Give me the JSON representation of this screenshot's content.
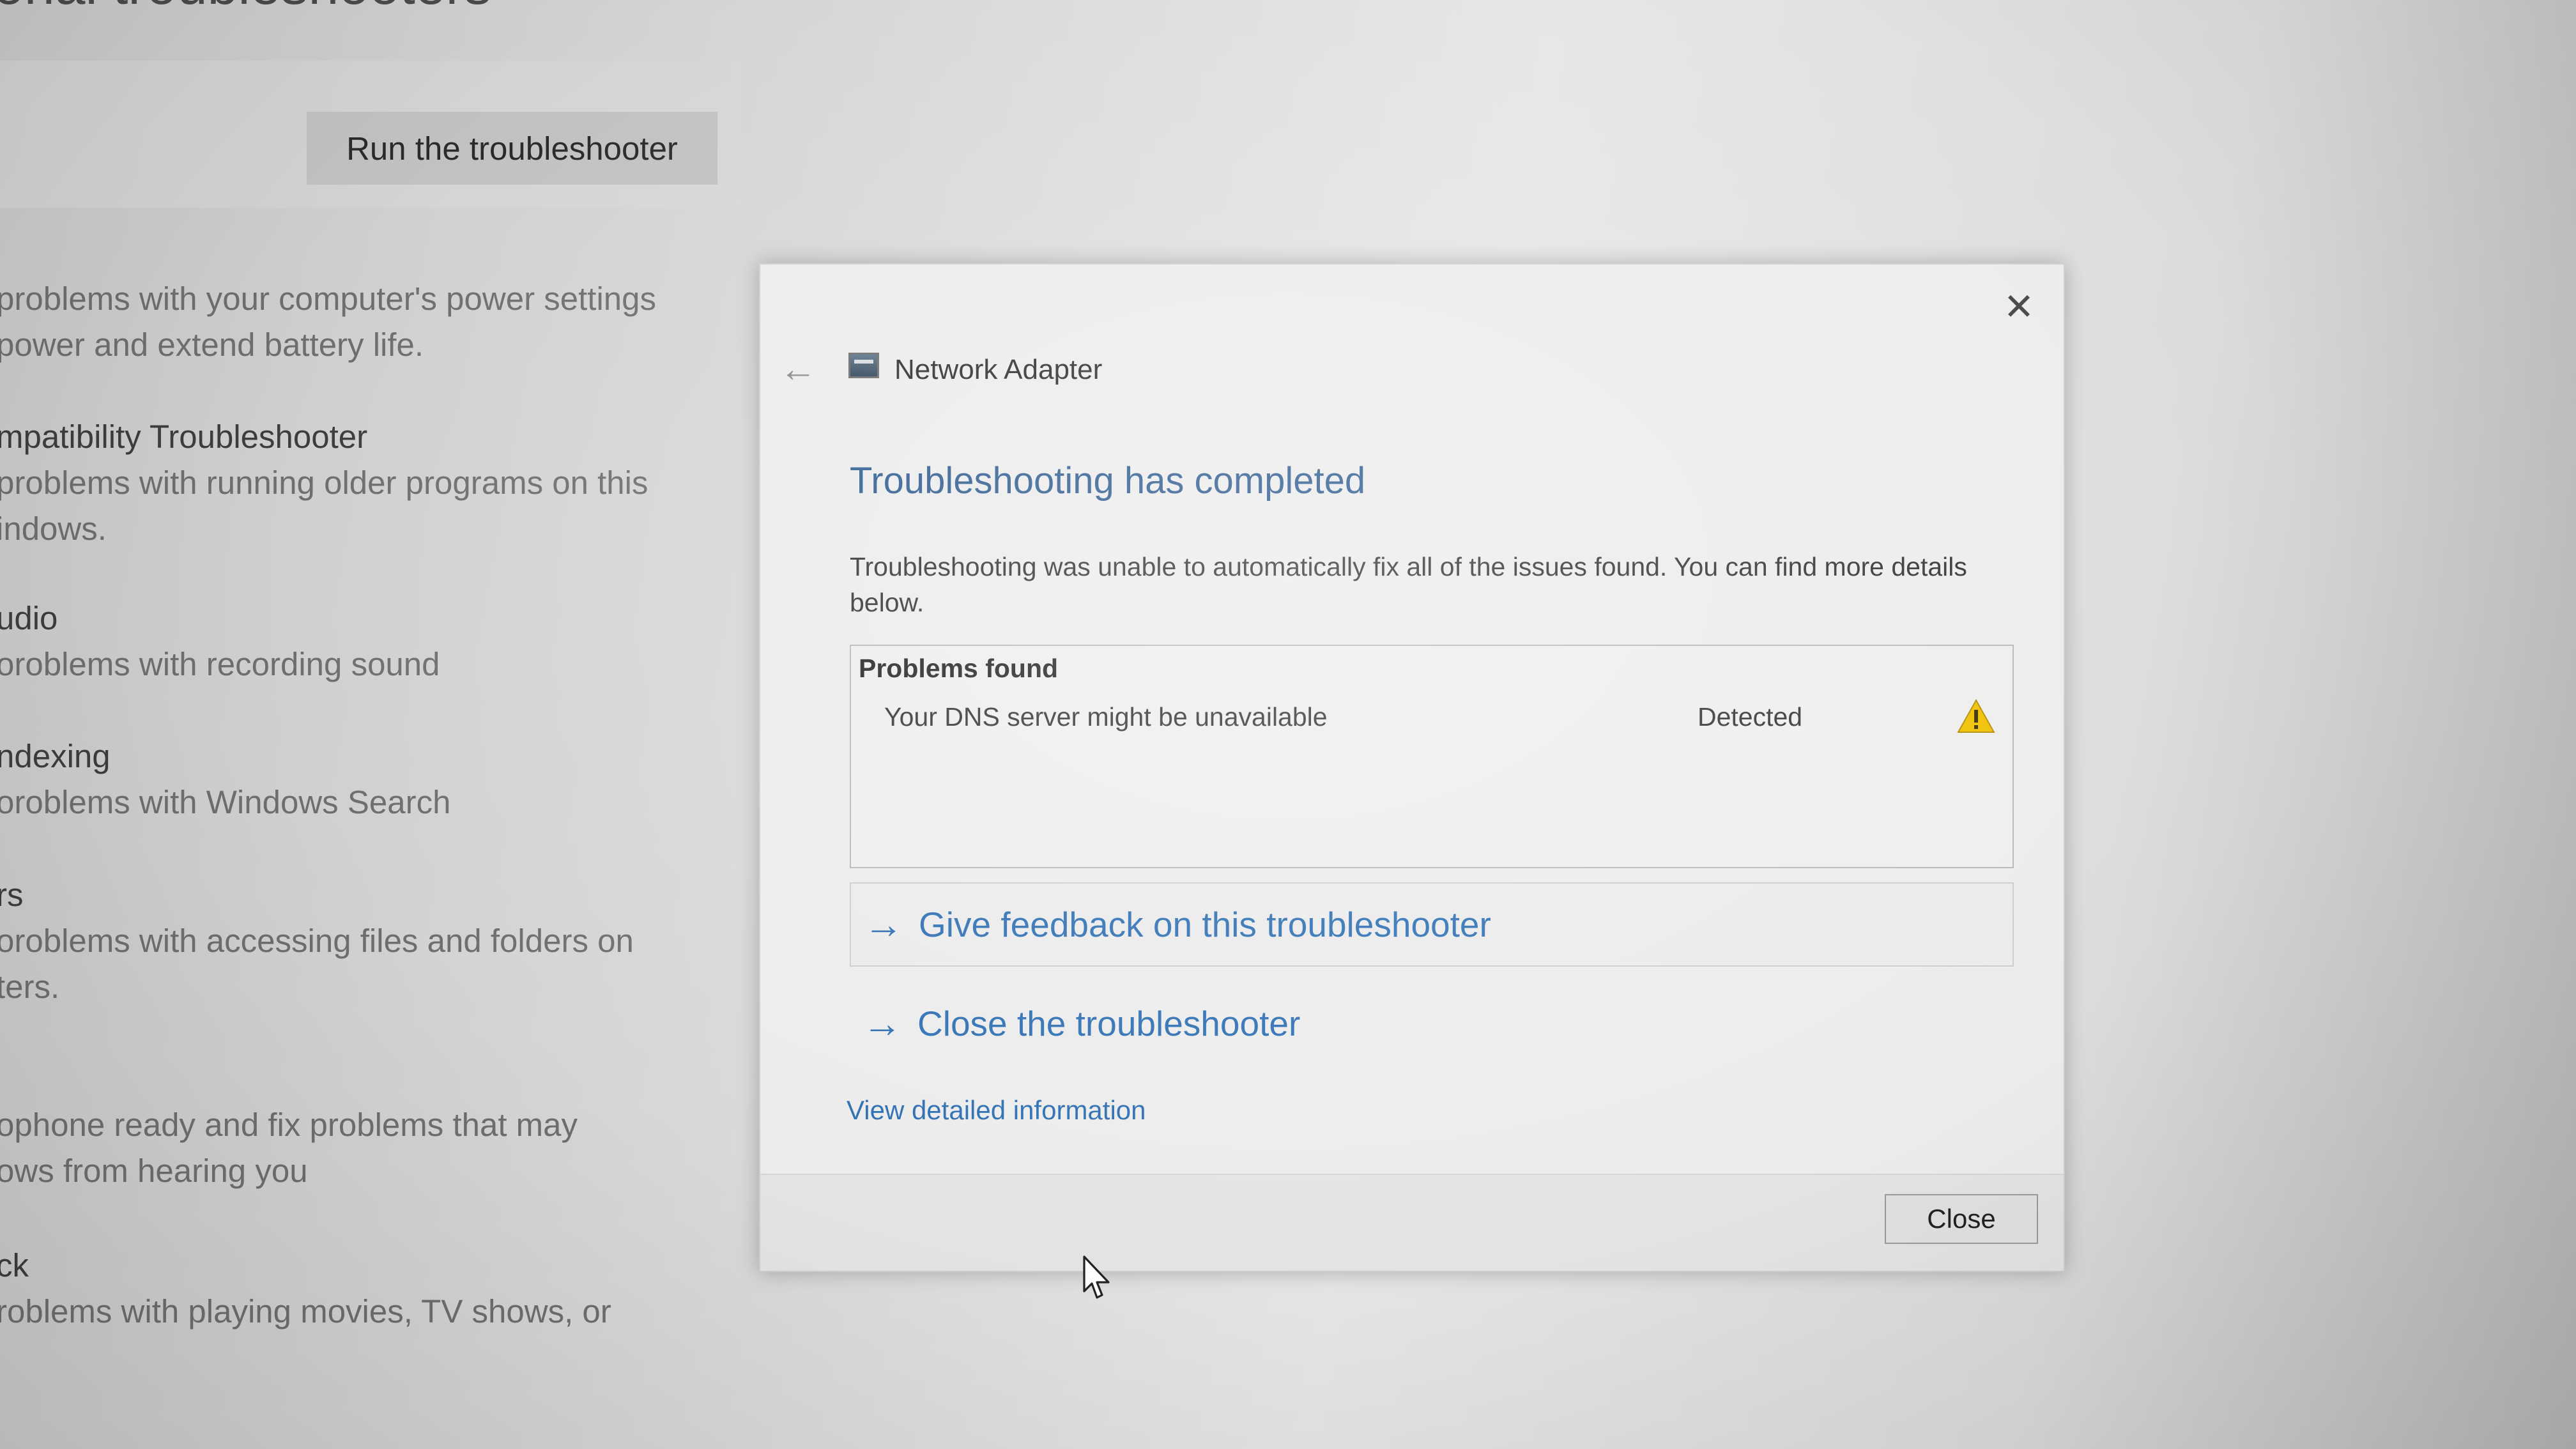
{
  "background": {
    "heading": "onal troubleshooters",
    "run_button": "Run the troubleshooter",
    "items": [
      {
        "lines": [
          "problems with your computer's power settings",
          "power and extend battery life."
        ]
      },
      {
        "title": "mpatibility Troubleshooter",
        "lines": [
          "problems with running older programs on this",
          "indows."
        ]
      },
      {
        "title": "udio",
        "lines": [
          "oroblems with recording sound"
        ]
      },
      {
        "title": "ndexing",
        "lines": [
          "oroblems with Windows Search"
        ]
      },
      {
        "title": "rs",
        "lines": [
          "oroblems with accessing files and folders on",
          "ters."
        ]
      },
      {
        "lines": [
          "ophone ready and fix problems that may",
          "ows from hearing you"
        ]
      },
      {
        "title": "ck",
        "lines": [
          "roblems with playing movies, TV shows, or"
        ]
      }
    ]
  },
  "dialog": {
    "close_glyph": "✕",
    "back_glyph": "←",
    "icon": "network-adapter-icon",
    "title": "Network Adapter",
    "heading": "Troubleshooting has completed",
    "description": "Troubleshooting was unable to automatically fix all of the issues found. You can find more details below.",
    "problems": {
      "header": "Problems found",
      "rows": [
        {
          "text": "Your DNS server might be unavailable",
          "status": "Detected",
          "icon": "warning-icon"
        }
      ]
    },
    "links": {
      "arrow": "→",
      "feedback": "Give feedback on this troubleshooter",
      "close_troubleshooter": "Close the troubleshooter"
    },
    "detail_link": "View detailed information",
    "footer_close": "Close"
  },
  "colors": {
    "link": "#2d6fb3",
    "heading": "#2d5b8f",
    "warning": "#f0c000"
  }
}
